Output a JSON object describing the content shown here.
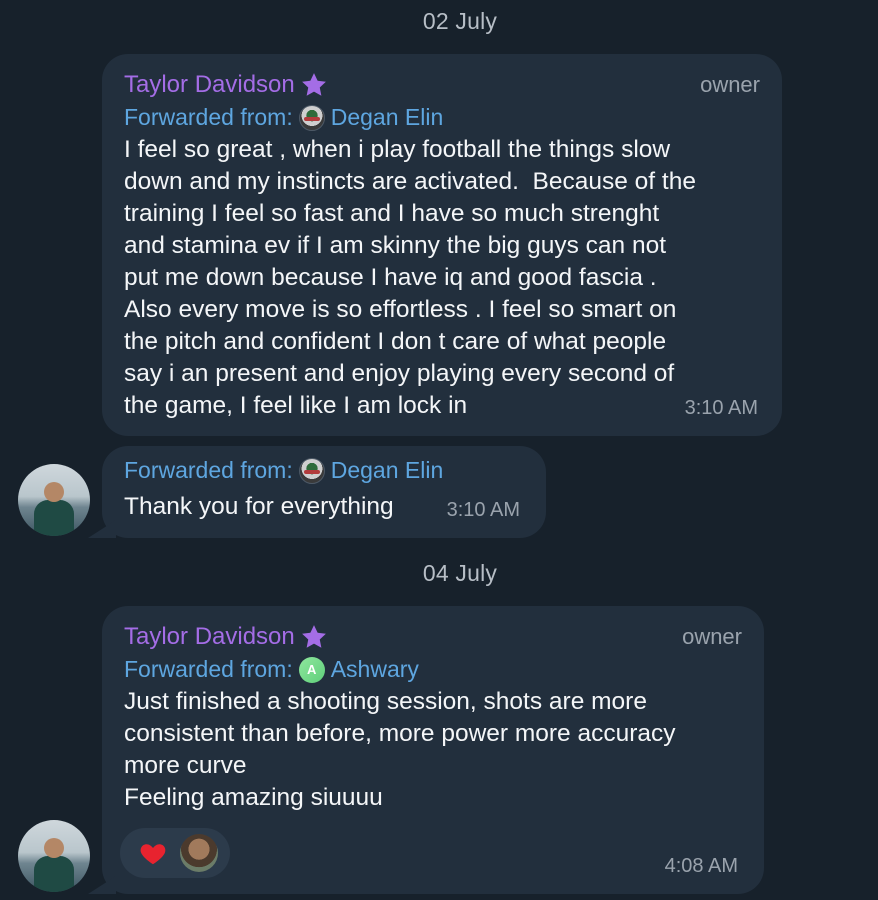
{
  "dates": [
    "02 July",
    "04 July"
  ],
  "messages": [
    {
      "sender": "Taylor Davidson",
      "role": "owner",
      "forwarded_label": "Forwarded from:",
      "forwarded_name": "Degan Elin",
      "text": "I feel so great , when i play football the things slow\ndown and my instincts are activated.  Because of the\ntraining I feel so fast and I have so much strenght\nand stamina ev if I am skinny the big guys can not\nput me down because I have iq and good fascia .\nAlso every move is so effortless . I feel so smart on\nthe pitch and confident I don t care of what people\nsay i an present and enjoy playing every second of\nthe game, I feel like I am lock in",
      "time": "3:10 AM"
    },
    {
      "forwarded_label": "Forwarded from:",
      "forwarded_name": "Degan Elin",
      "text": "Thank you for everything",
      "time": "3:10 AM"
    },
    {
      "sender": "Taylor Davidson",
      "role": "owner",
      "forwarded_label": "Forwarded from:",
      "forwarded_name": "Ashwary",
      "forwarded_initial": "A",
      "text": "Just finished a shooting session, shots are more\nconsistent than before, more power more accuracy\nmore curve\nFeeling amazing siuuuu",
      "time": "4:08 AM",
      "reaction": "heart"
    }
  ],
  "colors": {
    "background": "#17212b",
    "bubble": "#222f3d",
    "sender": "#a46de6",
    "forward_link": "#5ea6e0",
    "meta": "#9aa3ad"
  }
}
